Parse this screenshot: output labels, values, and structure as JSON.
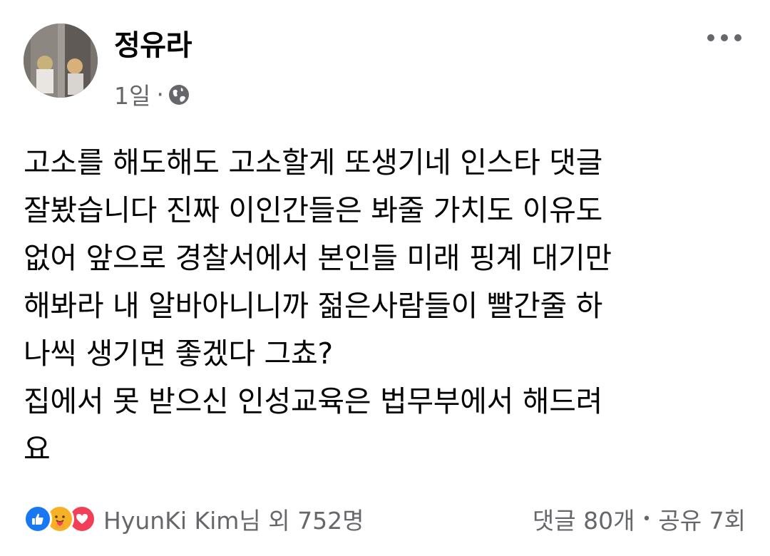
{
  "post": {
    "author": "정유라",
    "time": "1일",
    "separator": "·",
    "visibility_icon": "globe-icon",
    "body_lines": [
      "고소를 해도해도 고소할게 또생기네 인스타 댓글",
      "잘봤습니다 진짜 이인간들은 봐줄 가치도 이유도",
      "없어 앞으로 경찰서에서 본인들 미래 핑계 대기만",
      "해봐라 내 알바아니니까 젊은사람들이 빨간줄 하",
      "나씩 생기면 좋겠다 그쵸?",
      "집에서 못 받으신 인성교육은 법무부에서 해드려",
      "요"
    ]
  },
  "footer": {
    "reaction_icons": [
      "like-icon",
      "care-icon",
      "love-icon"
    ],
    "reactions_text": "HyunKi Kim님 외 752명",
    "comments": "댓글 80개",
    "bullet": "•",
    "shares": "공유 7회"
  },
  "colors": {
    "text": "#050505",
    "secondary": "#65676b",
    "like": "#1877f2",
    "care": "#f7b125",
    "love": "#f33e58"
  }
}
